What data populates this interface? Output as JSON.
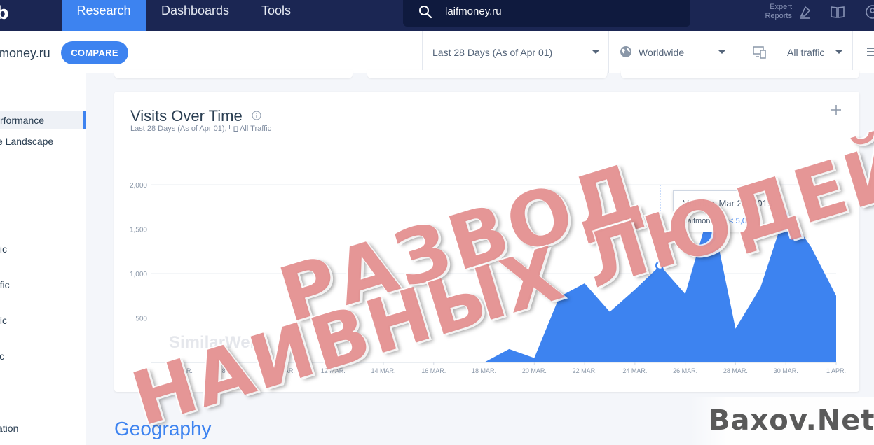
{
  "nav": {
    "brand": "b",
    "tabs": [
      {
        "label": "Research",
        "active": true
      },
      {
        "label": "Dashboards",
        "active": false
      },
      {
        "label": "Tools",
        "active": false
      }
    ],
    "search_value": "laifmoney.ru",
    "expert_reports": "Expert Reports"
  },
  "subheader": {
    "site": "money.ru",
    "compare_label": "COMPARE",
    "date_filter": "Last 28 Days (As of Apr 01)",
    "geo_filter": "Worldwide",
    "traffic_filter": "All traffic"
  },
  "sidebar": {
    "items": [
      {
        "label": "rformance",
        "active": true
      },
      {
        "label": "e Landscape",
        "active": false
      },
      {
        "label": "fic",
        "active": false
      },
      {
        "label": "ffic",
        "active": false
      },
      {
        "label": "fic",
        "active": false
      },
      {
        "label": "ic",
        "active": false
      },
      {
        "label": "ation",
        "active": false
      }
    ]
  },
  "card": {
    "title": "Visits Over Time",
    "subtitle": "Last 28 Days (As of Apr 01),",
    "subtitle_traffic": "All Traffic",
    "watermark": "SimilarWeb"
  },
  "tooltip": {
    "date": "Monday, Mar 25, 2019",
    "site": "laifmoney.ru",
    "value": "< 5,000"
  },
  "section_title": "Geography",
  "stamp": {
    "line1": "РАЗВОД",
    "line2": "НАИВНЫХ ЛЮДЕЙ"
  },
  "corner_watermark": "Baxov.Net",
  "colors": {
    "nav_bg": "#1b2653",
    "accent": "#3d83f0",
    "area_fill": "#3d83f0",
    "stamp": "#de7878"
  },
  "chart_data": {
    "type": "area",
    "title": "Visits Over Time",
    "ylim": [
      0,
      2000
    ],
    "yticks": [
      500,
      1000,
      1500,
      2000
    ],
    "ytick_labels": [
      "500",
      "1,000",
      "1,500",
      "2,000"
    ],
    "x_labels": [
      "6 MAR.",
      "8 MAR.",
      "10 MAR.",
      "12 MAR.",
      "14 MAR.",
      "16 MAR.",
      "18 MAR.",
      "20 MAR.",
      "22 MAR.",
      "24 MAR.",
      "26 MAR.",
      "28 MAR.",
      "30 MAR.",
      "1 APR."
    ],
    "x": [
      "5 MAR.",
      "6 MAR.",
      "7 MAR.",
      "8 MAR.",
      "9 MAR.",
      "10 MAR.",
      "11 MAR.",
      "12 MAR.",
      "13 MAR.",
      "14 MAR.",
      "15 MAR.",
      "16 MAR.",
      "17 MAR.",
      "18 MAR.",
      "19 MAR.",
      "20 MAR.",
      "21 MAR.",
      "22 MAR.",
      "23 MAR.",
      "24 MAR.",
      "25 MAR.",
      "26 MAR.",
      "27 MAR.",
      "28 MAR.",
      "29 MAR.",
      "30 MAR.",
      "31 MAR.",
      "1 APR."
    ],
    "series": [
      {
        "name": "laifmoney.ru",
        "values": [
          0,
          0,
          0,
          0,
          0,
          0,
          0,
          0,
          0,
          0,
          0,
          0,
          0,
          0,
          150,
          50,
          740,
          890,
          570,
          820,
          1090,
          770,
          1750,
          380,
          850,
          1710,
          1300,
          750
        ]
      }
    ],
    "highlight_index": 20
  }
}
